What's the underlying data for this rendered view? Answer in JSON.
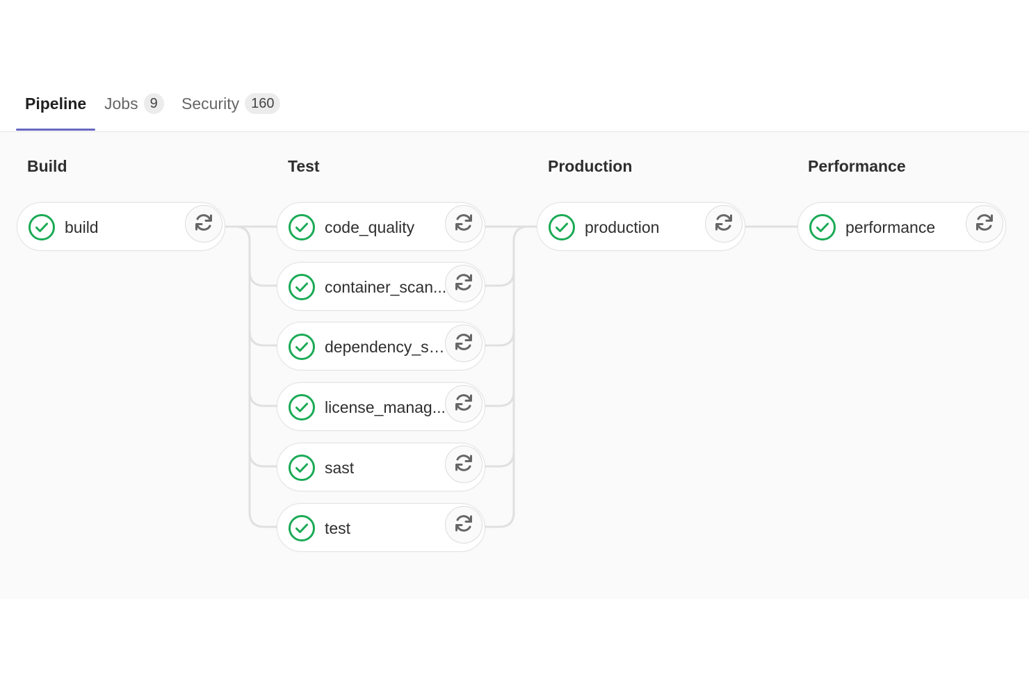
{
  "tabs": [
    {
      "label": "Pipeline",
      "count": null
    },
    {
      "label": "Jobs",
      "count": "9"
    },
    {
      "label": "Security",
      "count": "160"
    }
  ],
  "stages": [
    {
      "title": "Build",
      "jobs": [
        {
          "name": "build"
        }
      ]
    },
    {
      "title": "Test",
      "jobs": [
        {
          "name": "code_quality"
        },
        {
          "name": "container_scan..."
        },
        {
          "name": "dependency_sc..."
        },
        {
          "name": "license_manag..."
        },
        {
          "name": "sast"
        },
        {
          "name": "test"
        }
      ]
    },
    {
      "title": "Production",
      "jobs": [
        {
          "name": "production"
        }
      ]
    },
    {
      "title": "Performance",
      "jobs": [
        {
          "name": "performance"
        }
      ]
    }
  ],
  "colors": {
    "success": "#1aaa55",
    "accent": "#6666c4",
    "connector": "#e0e0e0"
  },
  "icons": {
    "status": "status-success-icon",
    "action": "retry-icon"
  }
}
